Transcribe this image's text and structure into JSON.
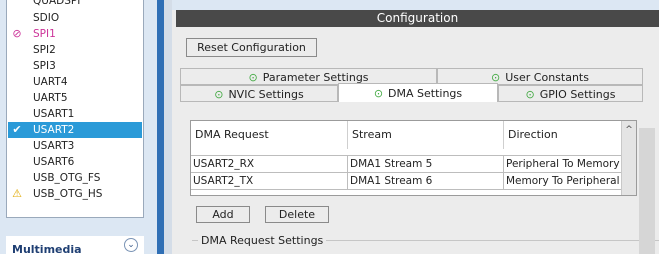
{
  "peripherals": [
    {
      "label": "QUADSPI",
      "status": "none"
    },
    {
      "label": "SDIO",
      "status": "none"
    },
    {
      "label": "SPI1",
      "status": "disabled"
    },
    {
      "label": "SPI2",
      "status": "none"
    },
    {
      "label": "SPI3",
      "status": "none"
    },
    {
      "label": "UART4",
      "status": "none"
    },
    {
      "label": "UART5",
      "status": "none"
    },
    {
      "label": "USART1",
      "status": "none"
    },
    {
      "label": "USART2",
      "status": "ok",
      "selected": true
    },
    {
      "label": "USART3",
      "status": "none"
    },
    {
      "label": "USART6",
      "status": "none"
    },
    {
      "label": "USB_OTG_FS",
      "status": "none"
    },
    {
      "label": "USB_OTG_HS",
      "status": "warning"
    }
  ],
  "category": {
    "title": "Multimedia",
    "toggle_icon": "double-chevron-down-icon",
    "toggle_glyph": "⌄"
  },
  "config": {
    "title": "Configuration",
    "reset_label": "Reset Configuration",
    "tabs_row1": [
      {
        "label": "Parameter Settings",
        "icon": "check-circle-icon"
      },
      {
        "label": "User Constants",
        "icon": "check-circle-icon"
      }
    ],
    "tabs_row2": [
      {
        "label": "NVIC Settings",
        "icon": "check-circle-icon"
      },
      {
        "label": "DMA Settings",
        "icon": "check-circle-icon",
        "active": true
      },
      {
        "label": "GPIO Settings",
        "icon": "check-circle-icon"
      }
    ]
  },
  "dma": {
    "columns": [
      "DMA Request",
      "Stream",
      "Direction"
    ],
    "rows": [
      [
        "USART2_RX",
        "DMA1 Stream 5",
        "Peripheral To Memory"
      ],
      [
        "USART2_TX",
        "DMA1 Stream 6",
        "Memory To Peripheral"
      ]
    ],
    "add_label": "Add",
    "delete_label": "Delete",
    "request_settings_label": "DMA Request Settings"
  },
  "icons": {
    "ok": "✔",
    "warning": "⚠",
    "disabled": "⊘",
    "check": "⊙",
    "scroll_up": "^"
  },
  "colors": {
    "selection": "#2a9ad8",
    "ok": "#33aa33",
    "warning": "#e0a800",
    "disabled": "#cc3399",
    "title_bar": "#494949"
  }
}
